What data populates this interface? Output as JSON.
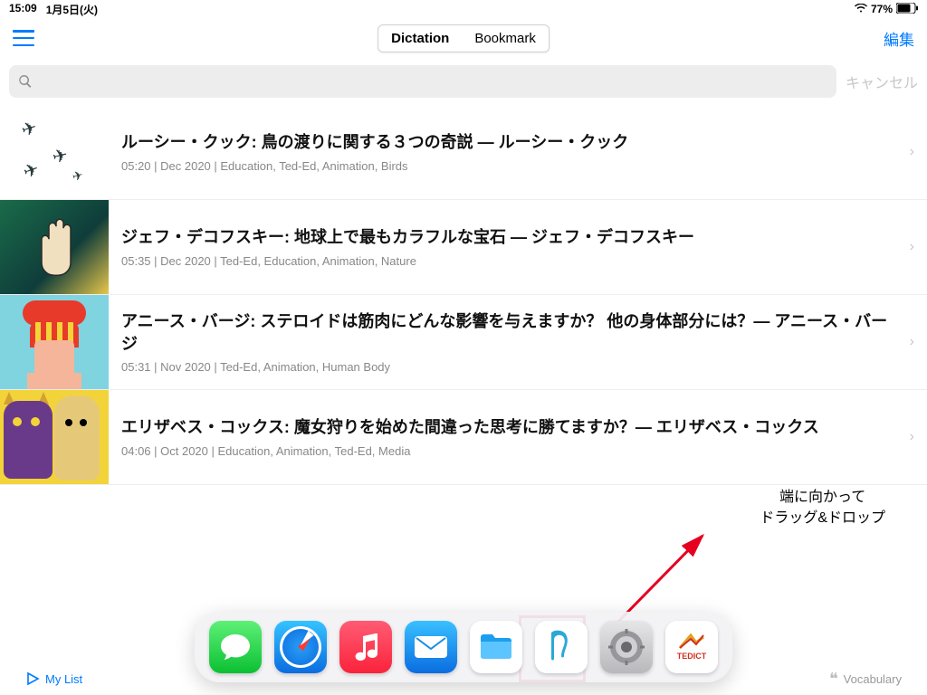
{
  "status": {
    "time": "15:09",
    "date": "1月5日(火)",
    "battery": "77%"
  },
  "nav": {
    "seg": {
      "dictation": "Dictation",
      "bookmark": "Bookmark"
    },
    "edit": "編集"
  },
  "search": {
    "placeholder": "",
    "cancel": "キャンセル"
  },
  "items": [
    {
      "title": "ルーシー・クック: 鳥の渡りに関する３つの奇説 ― ルーシー・クック",
      "meta": "05:20 | Dec 2020 | Education, Ted-Ed, Animation, Birds"
    },
    {
      "title": "ジェフ・デコフスキー: 地球上で最もカラフルな宝石 ― ジェフ・デコフスキー",
      "meta": "05:35 | Dec 2020 | Ted-Ed, Education, Animation, Nature"
    },
    {
      "title": "アニース・バージ: ステロイドは筋肉にどんな影響を与えますか？ 他の身体部分には？― アニース・バージ",
      "meta": "05:31 | Nov 2020 | Ted-Ed, Animation, Human Body"
    },
    {
      "title": "エリザベス・コックス: 魔女狩りを始めた間違った思考に勝てますか？― エリザベス・コックス",
      "meta": "04:06 | Oct 2020 | Education, Animation, Ted-Ed, Media"
    }
  ],
  "annotation": {
    "line1": "端に向かって",
    "line2": "ドラッグ&ドロップ"
  },
  "dock": {
    "apps": [
      "messages",
      "safari",
      "music",
      "mail",
      "files",
      "notability",
      "settings",
      "tedict"
    ],
    "tedict_label": "TEDICT"
  },
  "bottom": {
    "mylist": "My List",
    "vocabulary": "Vocabulary"
  }
}
